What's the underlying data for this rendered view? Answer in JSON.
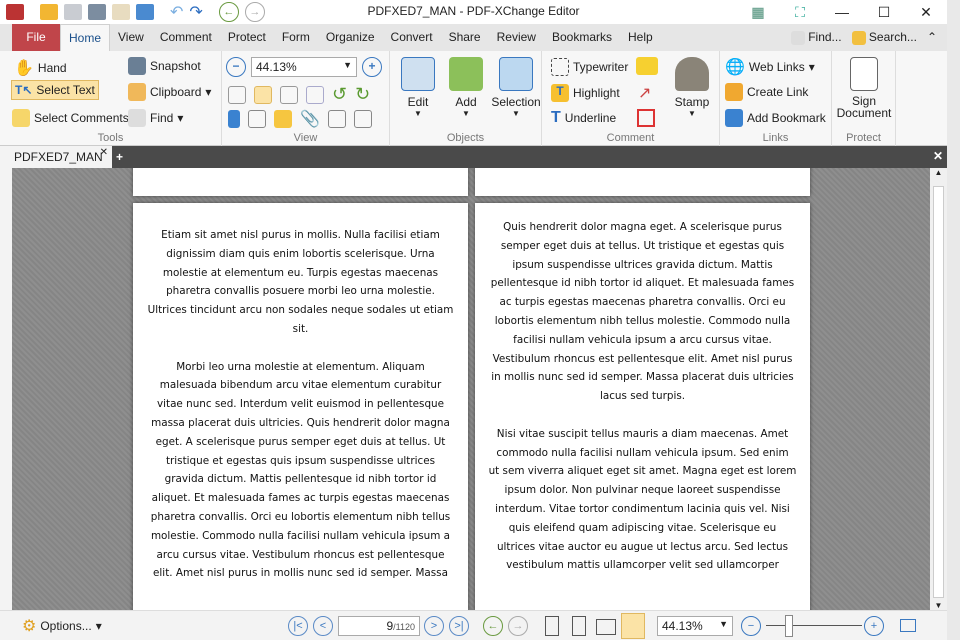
{
  "window": {
    "title": "PDFXED7_MAN - PDF-XChange Editor"
  },
  "menu_tabs": [
    "File",
    "Home",
    "View",
    "Comment",
    "Protect",
    "Form",
    "Organize",
    "Convert",
    "Share",
    "Review",
    "Bookmarks",
    "Help"
  ],
  "menu_right": {
    "find": "Find...",
    "search": "Search..."
  },
  "ribbon": {
    "tools": {
      "hand": "Hand",
      "select_text": "Select Text",
      "select_comments": "Select Comments",
      "snapshot": "Snapshot",
      "clipboard": "Clipboard",
      "find": "Find",
      "label": "Tools"
    },
    "view": {
      "zoom": "44.13%",
      "label": "View"
    },
    "objects": {
      "edit": "Edit",
      "add": "Add",
      "selection": "Selection",
      "label": "Objects"
    },
    "comment": {
      "typewriter": "Typewriter",
      "highlight": "Highlight",
      "underline": "Underline",
      "stamp": "Stamp",
      "label": "Comment"
    },
    "links": {
      "web_links": "Web Links",
      "create_link": "Create Link",
      "add_bookmark": "Add Bookmark",
      "label": "Links"
    },
    "protect": {
      "sign": "Sign",
      "document": "Document",
      "label": "Protect"
    }
  },
  "doc_tab": "PDFXED7_MAN",
  "pages": {
    "left": [
      [
        "Etiam sit amet nisl purus in mollis. Nulla facilisi etiam",
        "dignissim diam quis enim lobortis scelerisque. Urna",
        "molestie at elementum eu. Turpis egestas maecenas",
        "pharetra convallis posuere morbi leo urna molestie.",
        "Ultrices tincidunt arcu non sodales neque sodales ut etiam",
        "sit."
      ],
      [
        "Morbi leo urna molestie at elementum. Aliquam",
        "malesuada bibendum arcu vitae elementum curabitur",
        "vitae nunc sed. Interdum velit euismod in pellentesque",
        "massa placerat duis ultricies. Quis hendrerit dolor magna",
        "eget. A scelerisque purus semper eget duis at tellus. Ut",
        "tristique et egestas quis ipsum suspendisse ultrices",
        "gravida dictum. Mattis pellentesque id nibh tortor id",
        "aliquet. Et malesuada fames ac turpis egestas maecenas",
        "pharetra convallis. Orci eu lobortis elementum nibh tellus",
        "molestie. Commodo nulla facilisi nullam vehicula ipsum a",
        "arcu cursus vitae. Vestibulum rhoncus est pellentesque",
        "elit. Amet nisl purus in mollis nunc sed id semper. Massa"
      ]
    ],
    "right": [
      [
        "Quis hendrerit dolor magna eget. A scelerisque purus",
        "semper eget duis at tellus. Ut tristique et egestas quis",
        "ipsum suspendisse ultrices gravida dictum. Mattis",
        "pellentesque id nibh tortor id aliquet. Et malesuada fames",
        "ac turpis egestas maecenas pharetra convallis. Orci eu",
        "lobortis elementum nibh tellus molestie. Commodo nulla",
        "facilisi nullam vehicula ipsum a arcu cursus vitae.",
        "Vestibulum rhoncus est pellentesque elit. Amet nisl purus",
        "in mollis nunc sed id semper. Massa placerat duis ultricies",
        "lacus sed turpis."
      ],
      [
        "Nisi vitae suscipit tellus mauris a diam maecenas. Amet",
        "commodo nulla facilisi nullam vehicula ipsum. Sed enim",
        "ut sem viverra aliquet eget sit amet. Magna eget est lorem",
        "ipsum dolor. Non pulvinar neque laoreet suspendisse",
        "interdum. Vitae tortor condimentum lacinia quis vel. Nisi",
        "quis eleifend quam adipiscing vitae. Scelerisque eu",
        "ultrices vitae auctor eu augue ut lectus arcu. Sed lectus",
        "vestibulum mattis ullamcorper velit sed ullamcorper"
      ]
    ]
  },
  "status": {
    "options": "Options...",
    "current_page": "9",
    "total_pages": "/1120",
    "zoom": "44.13%"
  },
  "colors": {
    "file_tab": "#c0454a",
    "accent": "#3a78c0",
    "selected": "#fbe3a6"
  }
}
